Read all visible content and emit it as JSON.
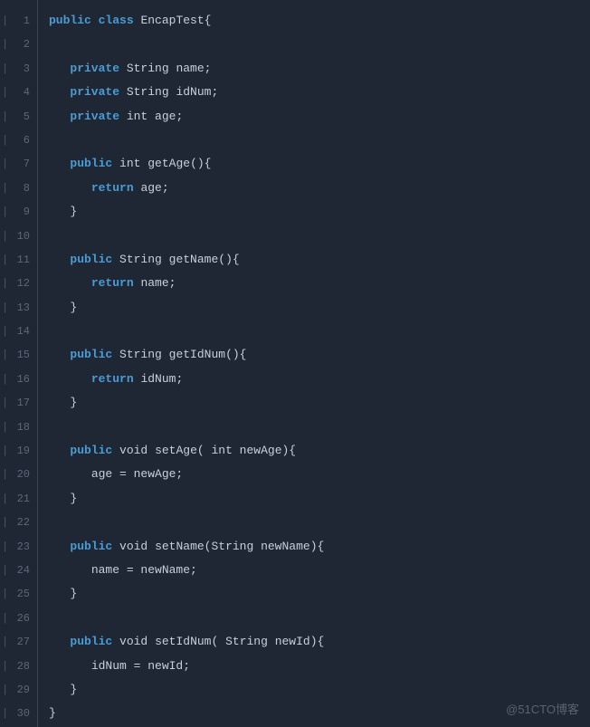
{
  "watermark": "@51CTO博客",
  "lineNumbers": [
    "1",
    "2",
    "3",
    "4",
    "5",
    "6",
    "7",
    "8",
    "9",
    "10",
    "11",
    "12",
    "13",
    "14",
    "15",
    "16",
    "17",
    "18",
    "19",
    "20",
    "21",
    "22",
    "23",
    "24",
    "25",
    "26",
    "27",
    "28",
    "29",
    "30"
  ],
  "code": {
    "l1": {
      "kw1": "public",
      "kw2": "class",
      "name": "EncapTest",
      "brace": "{"
    },
    "l3": {
      "kw": "private",
      "type": "String",
      "name": "name",
      "semi": ";"
    },
    "l4": {
      "kw": "private",
      "type": "String",
      "name": "idNum",
      "semi": ";"
    },
    "l5": {
      "kw": "private",
      "type": "int",
      "name": "age",
      "semi": ";"
    },
    "l7": {
      "kw": "public",
      "type": "int",
      "name": "getAge",
      "paren": "(){"
    },
    "l8": {
      "kw": "return",
      "name": "age",
      "semi": ";"
    },
    "l9": {
      "brace": "}"
    },
    "l11": {
      "kw": "public",
      "type": "String",
      "name": "getName",
      "paren": "(){"
    },
    "l12": {
      "kw": "return",
      "name": "name",
      "semi": ";"
    },
    "l13": {
      "brace": "}"
    },
    "l15": {
      "kw": "public",
      "type": "String",
      "name": "getIdNum",
      "paren": "(){"
    },
    "l16": {
      "kw": "return",
      "name": "idNum",
      "semi": ";"
    },
    "l17": {
      "brace": "}"
    },
    "l19": {
      "kw": "public",
      "type": "void",
      "name": "setAge",
      "paren": "( int newAge){"
    },
    "l20": {
      "text": "age = newAge;"
    },
    "l21": {
      "brace": "}"
    },
    "l23": {
      "kw": "public",
      "type": "void",
      "name": "setName",
      "paren": "(String newName){"
    },
    "l24": {
      "text": "name = newName;"
    },
    "l25": {
      "brace": "}"
    },
    "l27": {
      "kw": "public",
      "type": "void",
      "name": "setIdNum",
      "paren": "( String newId){"
    },
    "l28": {
      "text": "idNum = newId;"
    },
    "l29": {
      "brace": "}"
    },
    "l30": {
      "brace": "}"
    }
  }
}
